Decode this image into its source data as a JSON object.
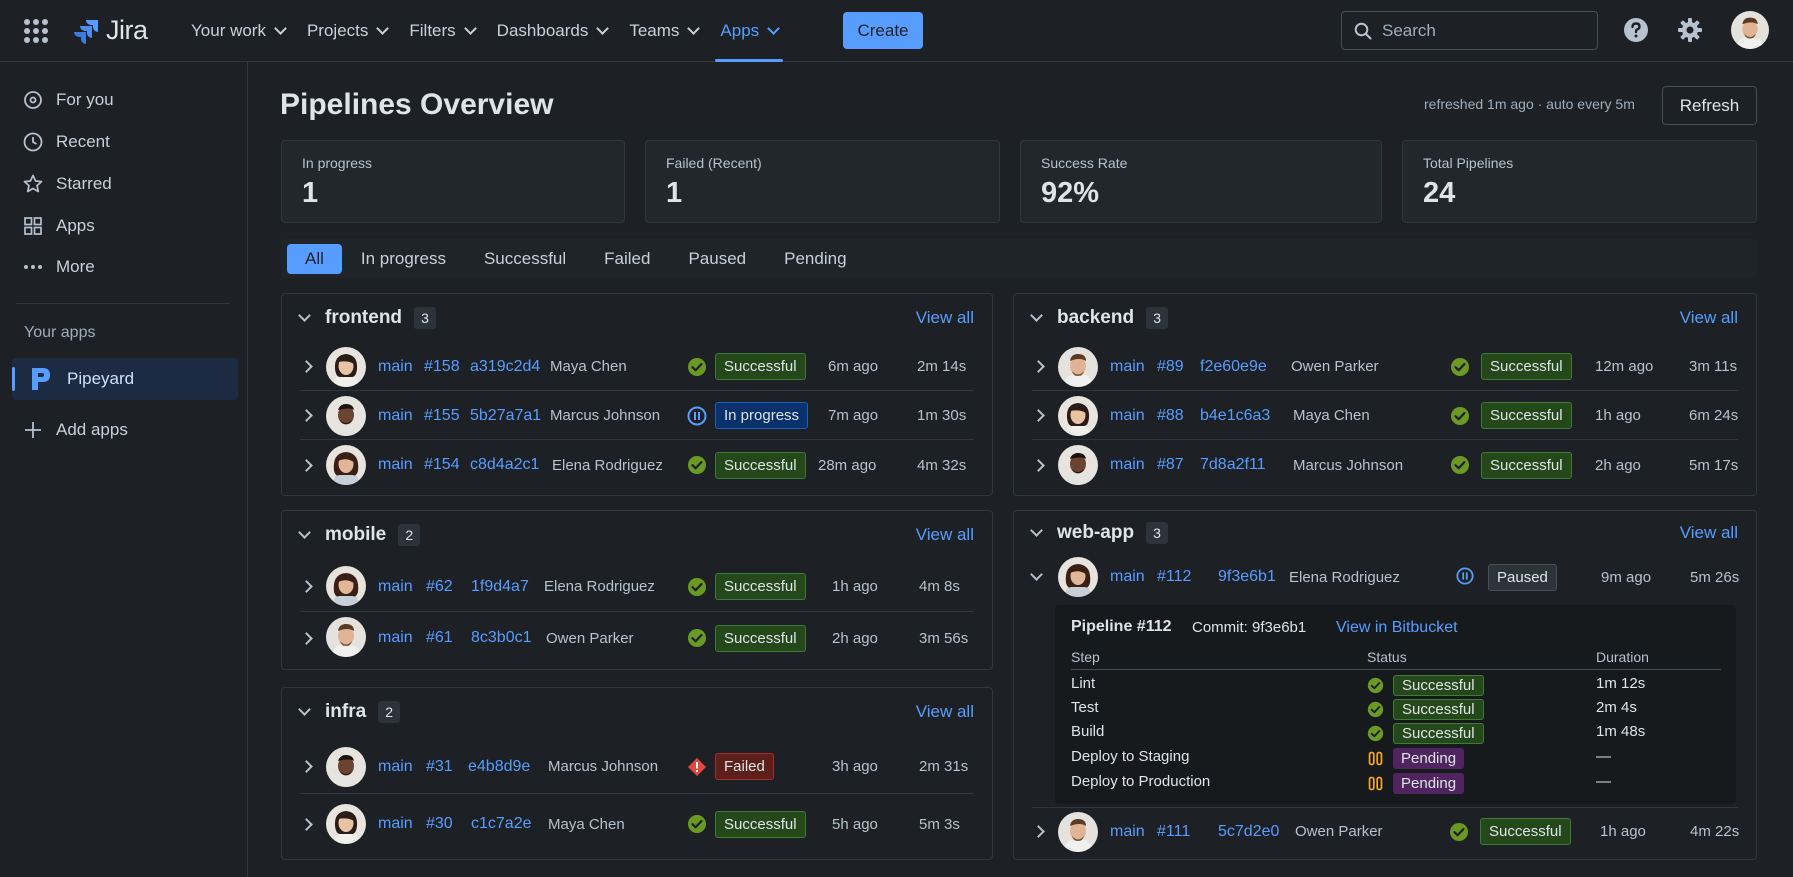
{
  "app": {
    "name": "Jira"
  },
  "nav": {
    "your_work": "Your work",
    "projects": "Projects",
    "filters": "Filters",
    "dashboards": "Dashboards",
    "teams": "Teams",
    "apps": "Apps",
    "create": "Create",
    "search_placeholder": "Search"
  },
  "sidebar": {
    "for_you": "For you",
    "recent": "Recent",
    "starred": "Starred",
    "apps": "Apps",
    "more": "More",
    "your_apps_heading": "Your apps",
    "app_name": "Pipeyard",
    "add_apps": "Add apps"
  },
  "page": {
    "title": "Pipelines Overview",
    "refreshed": "refreshed 1m ago · auto every 5m",
    "refresh_button": "Refresh"
  },
  "stats": [
    {
      "label": "In progress",
      "value": "1"
    },
    {
      "label": "Failed (Recent)",
      "value": "1"
    },
    {
      "label": "Success Rate",
      "value": "92%"
    },
    {
      "label": "Total Pipelines",
      "value": "24"
    }
  ],
  "filters": [
    "All",
    "In progress",
    "Successful",
    "Failed",
    "Paused",
    "Pending"
  ],
  "panels": {
    "frontend": {
      "name": "frontend",
      "count": "3",
      "view_all": "View all",
      "rows": [
        {
          "branch": "main",
          "num": "#158",
          "commit": "a319c2d4",
          "author": "Maya Chen",
          "status": "Successful",
          "ago": "6m ago",
          "duration": "2m 14s"
        },
        {
          "branch": "main",
          "num": "#155",
          "commit": "5b27a7a1",
          "author": "Marcus Johnson",
          "status": "In progress",
          "ago": "7m ago",
          "duration": "1m 30s"
        },
        {
          "branch": "main",
          "num": "#154",
          "commit": "c8d4a2c1",
          "author": "Elena Rodriguez",
          "status": "Successful",
          "ago": "28m ago",
          "duration": "4m 32s"
        }
      ]
    },
    "mobile": {
      "name": "mobile",
      "count": "2",
      "view_all": "View all",
      "rows": [
        {
          "branch": "main",
          "num": "#62",
          "commit": "1f9d4a7",
          "author": "Elena Rodriguez",
          "status": "Successful",
          "ago": "1h ago",
          "duration": "4m 8s"
        },
        {
          "branch": "main",
          "num": "#61",
          "commit": "8c3b0c1",
          "author": "Owen Parker",
          "status": "Successful",
          "ago": "2h ago",
          "duration": "3m 56s"
        }
      ]
    },
    "infra": {
      "name": "infra",
      "count": "2",
      "view_all": "View all",
      "rows": [
        {
          "branch": "main",
          "num": "#31",
          "commit": "e4b8d9e",
          "author": "Marcus Johnson",
          "status": "Failed",
          "ago": "3h ago",
          "duration": "2m 31s"
        },
        {
          "branch": "main",
          "num": "#30",
          "commit": "c1c7a2e",
          "author": "Maya Chen",
          "status": "Successful",
          "ago": "5h ago",
          "duration": "5m 3s"
        }
      ]
    },
    "backend": {
      "name": "backend",
      "count": "3",
      "view_all": "View all",
      "rows": [
        {
          "branch": "main",
          "num": "#89",
          "commit": "f2e60e9e",
          "author": "Owen Parker",
          "status": "Successful",
          "ago": "12m ago",
          "duration": "3m 11s"
        },
        {
          "branch": "main",
          "num": "#88",
          "commit": "b4e1c6a3",
          "author": "Maya Chen",
          "status": "Successful",
          "ago": "1h ago",
          "duration": "6m 24s"
        },
        {
          "branch": "main",
          "num": "#87",
          "commit": "7d8a2f11",
          "author": "Marcus Johnson",
          "status": "Successful",
          "ago": "2h ago",
          "duration": "5m 17s"
        }
      ]
    },
    "webapp": {
      "name": "web-app",
      "count": "3",
      "view_all": "View all",
      "rows": [
        {
          "branch": "main",
          "num": "#112",
          "commit": "9f3e6b1",
          "author": "Elena Rodriguez",
          "status": "Paused",
          "ago": "9m ago",
          "duration": "5m 26s"
        },
        {
          "branch": "main",
          "num": "#111",
          "commit": "5c7d2e0",
          "author": "Owen Parker",
          "status": "Successful",
          "ago": "1h ago",
          "duration": "4m 22s"
        }
      ],
      "detail": {
        "title": "Pipeline #112",
        "commit": "Commit: 9f3e6b1",
        "link": "View in Bitbucket",
        "headers": [
          "Step",
          "Status",
          "Duration"
        ],
        "steps": [
          {
            "step": "Lint",
            "status": "Successful",
            "duration": "1m 12s"
          },
          {
            "step": "Test",
            "status": "Successful",
            "duration": "2m 4s"
          },
          {
            "step": "Build",
            "status": "Successful",
            "duration": "1m 48s"
          },
          {
            "step": "Deploy to Staging",
            "status": "Pending",
            "duration": "—"
          },
          {
            "step": "Deploy to Production",
            "status": "Pending",
            "duration": "—"
          }
        ]
      }
    }
  },
  "colors": {
    "accent": "#579dff",
    "success": "#6a9a23",
    "failed": "#e2483d",
    "pending": "#f5a623"
  }
}
